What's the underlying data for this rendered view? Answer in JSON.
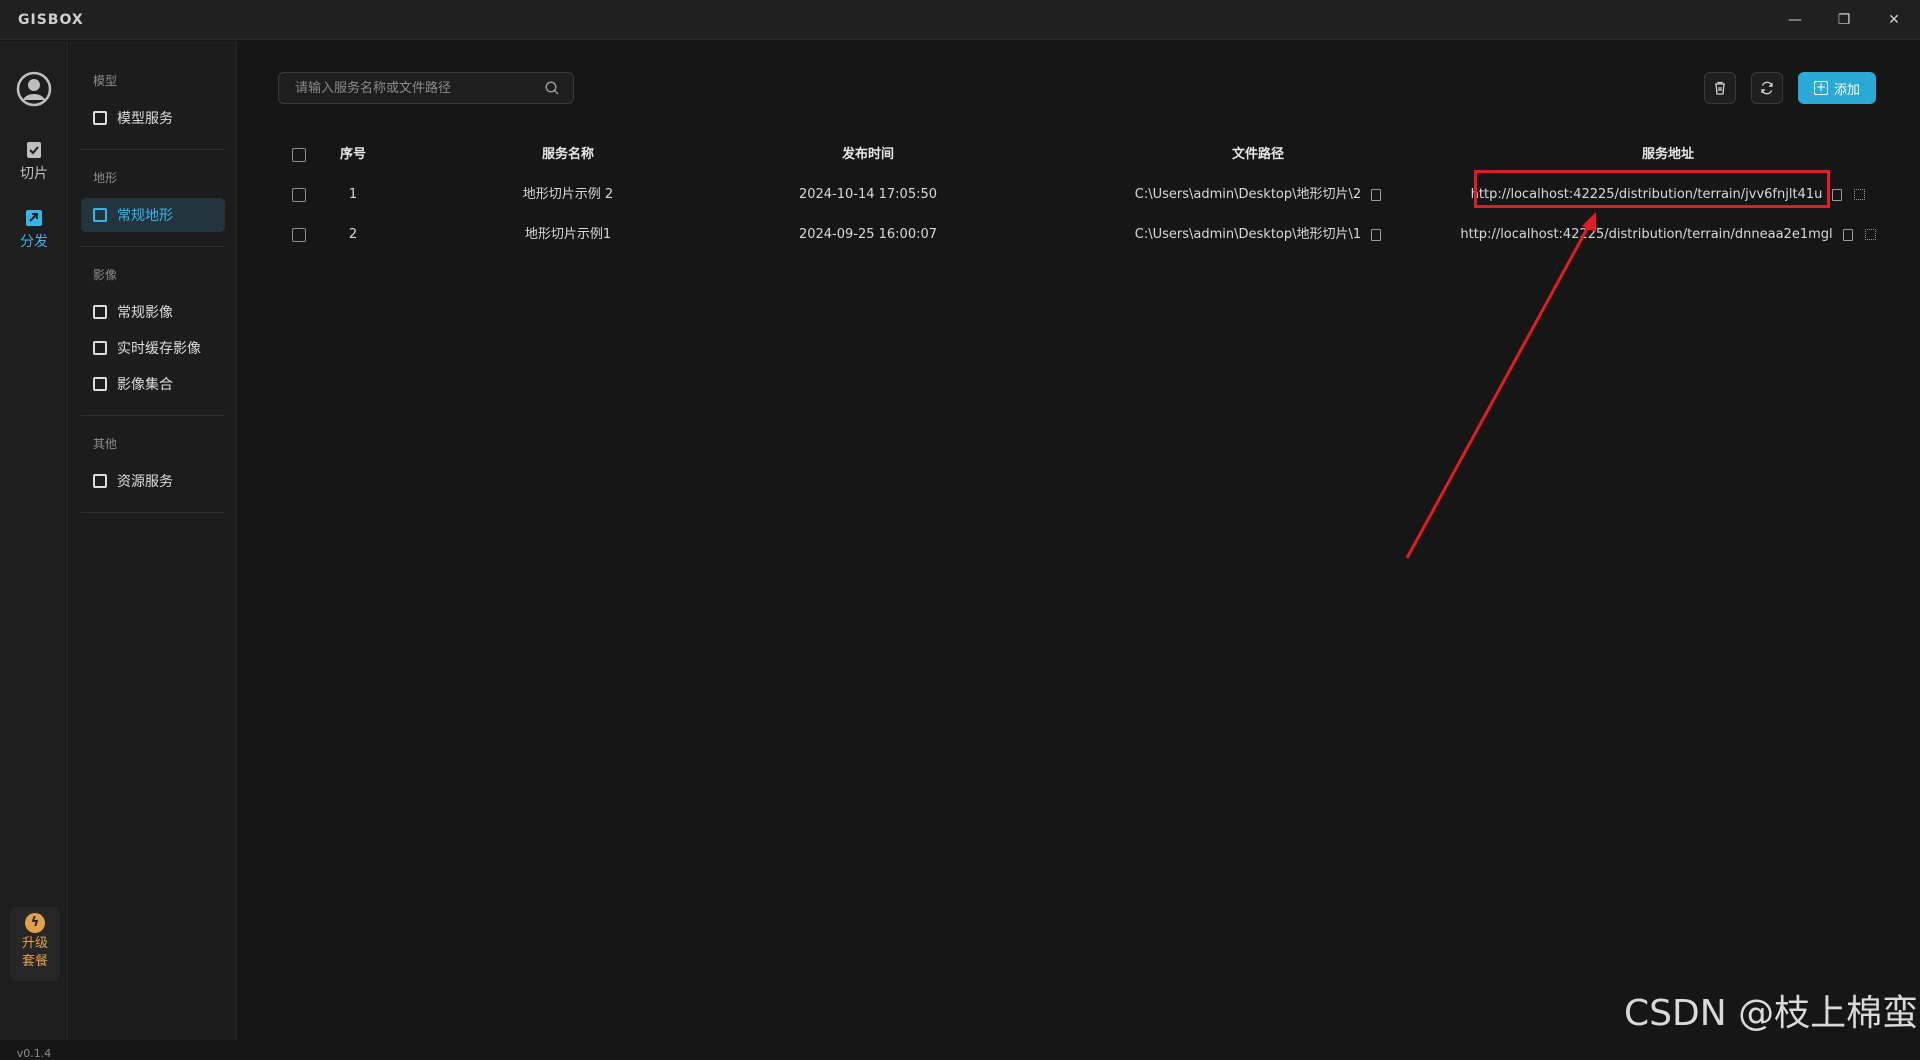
{
  "app": {
    "title": "GISBOX",
    "version": "v0.1.4"
  },
  "window_controls": {
    "minimize": "—",
    "restore": "❐",
    "close": "✕"
  },
  "rail": {
    "items": [
      {
        "label": "切片",
        "icon": "slice-icon",
        "active": false
      },
      {
        "label": "分发",
        "icon": "distribute-icon",
        "active": true
      }
    ],
    "upgrade": {
      "line1": "升级",
      "line2": "套餐",
      "icon": "bolt-icon"
    }
  },
  "sidebar": {
    "groups": [
      {
        "title": "模型",
        "items": [
          {
            "label": "模型服务",
            "active": false
          }
        ]
      },
      {
        "title": "地形",
        "items": [
          {
            "label": "常规地形",
            "active": true
          }
        ]
      },
      {
        "title": "影像",
        "items": [
          {
            "label": "常规影像",
            "active": false
          },
          {
            "label": "实时缓存影像",
            "active": false
          },
          {
            "label": "影像集合",
            "active": false
          }
        ]
      },
      {
        "title": "其他",
        "items": [
          {
            "label": "资源服务",
            "active": false
          }
        ]
      }
    ]
  },
  "toolbar": {
    "search_placeholder": "请输入服务名称或文件路径",
    "add_label": "添加"
  },
  "table": {
    "headers": {
      "index": "序号",
      "name": "服务名称",
      "time": "发布时间",
      "path": "文件路径",
      "url": "服务地址"
    },
    "rows": [
      {
        "index": "1",
        "name": "地形切片示例 2",
        "time": "2024-10-14 17:05:50",
        "path": "C:\\Users\\admin\\Desktop\\地形切片\\2",
        "url": "http://localhost:42225/distribution/terrain/jvv6fnjlt41u"
      },
      {
        "index": "2",
        "name": "地形切片示例1",
        "time": "2024-09-25 16:00:07",
        "path": "C:\\Users\\admin\\Desktop\\地形切片\\1",
        "url": "http://localhost:42225/distribution/terrain/dnneaa2e1mgl"
      }
    ]
  },
  "annotation": {
    "color": "#e21c24"
  },
  "watermark": "CSDN @枝上棉蛮",
  "colors": {
    "accent": "#35b6e6",
    "add_button": "#2aa8d6",
    "upgrade": "#e0a14a"
  }
}
